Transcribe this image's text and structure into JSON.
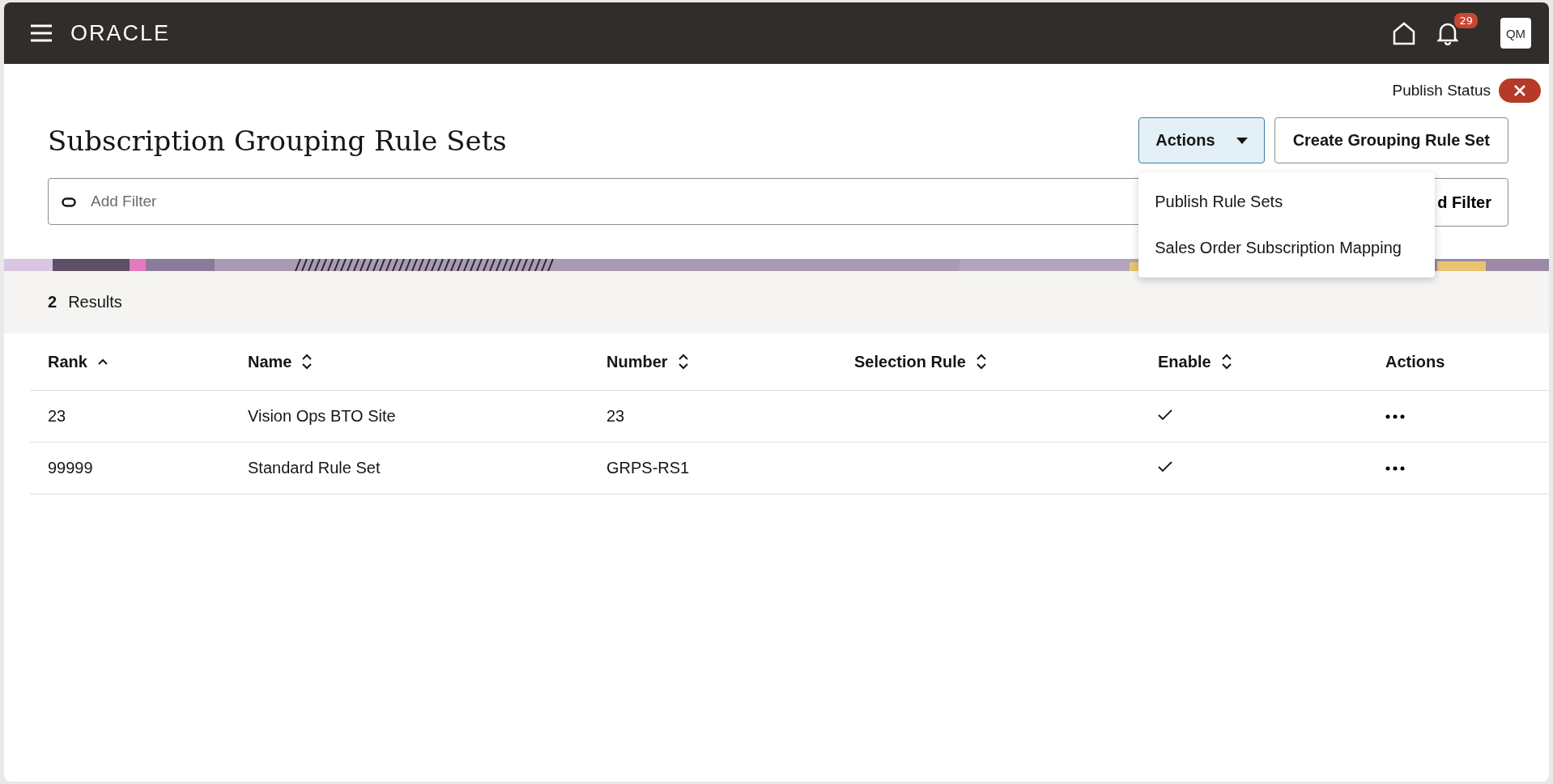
{
  "top_bar": {
    "brand": "ORACLE",
    "notification_count": "29",
    "avatar": "QM"
  },
  "publish_status": {
    "label": "Publish Status"
  },
  "page_title": "Subscription Grouping Rule Sets",
  "actions_menu": {
    "label": "Actions",
    "expanded": true,
    "items": [
      {
        "label": "Publish Rule Sets"
      },
      {
        "label": "Sales Order Subscription Mapping"
      }
    ]
  },
  "create_button": "Create Grouping Rule Set",
  "filter": {
    "placeholder": "Add Filter",
    "add_filter_button": "d Filter"
  },
  "results": {
    "count": "2",
    "label": "Results"
  },
  "table": {
    "columns": [
      {
        "label": "Rank",
        "sortable": true,
        "sorted": true
      },
      {
        "label": "Name",
        "sortable": true,
        "sorted": false
      },
      {
        "label": "Number",
        "sortable": true,
        "sorted": false
      },
      {
        "label": "Selection Rule",
        "sortable": true,
        "sorted": false
      },
      {
        "label": "Enable",
        "sortable": true,
        "sorted": false
      },
      {
        "label": "Actions",
        "sortable": false
      }
    ],
    "rows": [
      {
        "rank": "23",
        "name": "Vision Ops BTO Site",
        "number": "23",
        "enabled": true
      },
      {
        "rank": "99999",
        "name": "Standard Rule Set",
        "number": "GRPS-RS1",
        "enabled": true
      }
    ]
  }
}
